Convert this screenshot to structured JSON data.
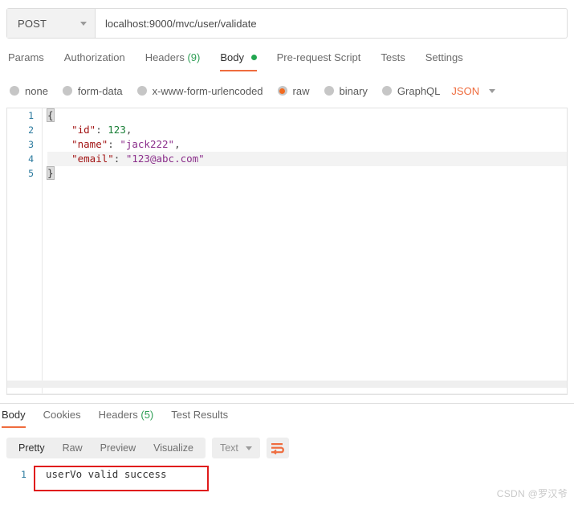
{
  "request": {
    "method": "POST",
    "url": "localhost:9000/mvc/user/validate",
    "method_caret_icon": "chevron-down-icon",
    "tabs": [
      {
        "label": "Params",
        "active": false
      },
      {
        "label": "Authorization",
        "active": false
      },
      {
        "label": "Headers",
        "count": "(9)",
        "active": false
      },
      {
        "label": "Body",
        "active": true,
        "dot": "green-dot-icon"
      },
      {
        "label": "Pre-request Script",
        "active": false
      },
      {
        "label": "Tests",
        "active": false
      },
      {
        "label": "Settings",
        "active": false
      }
    ],
    "body_types": [
      {
        "label": "none",
        "selected": false
      },
      {
        "label": "form-data",
        "selected": false
      },
      {
        "label": "x-www-form-urlencoded",
        "selected": false
      },
      {
        "label": "raw",
        "selected": true
      },
      {
        "label": "binary",
        "selected": false
      },
      {
        "label": "GraphQL",
        "selected": false
      }
    ],
    "format": "JSON",
    "format_caret_icon": "chevron-down-icon",
    "editor": {
      "line_numbers": [
        "1",
        "2",
        "3",
        "4",
        "5"
      ],
      "lines": [
        {
          "open_brace": "{"
        },
        {
          "indent": "    ",
          "key": "\"id\"",
          "colon": ": ",
          "num": "123",
          "tail": ","
        },
        {
          "indent": "    ",
          "key": "\"name\"",
          "colon": ": ",
          "str": "\"jack222\"",
          "tail": ","
        },
        {
          "indent": "    ",
          "key": "\"email\"",
          "colon": ": ",
          "str": "\"123@abc.com\"",
          "tail": ""
        },
        {
          "close_brace": "}"
        }
      ]
    }
  },
  "response": {
    "tabs": [
      {
        "label": "Body",
        "active": true
      },
      {
        "label": "Cookies",
        "active": false
      },
      {
        "label": "Headers",
        "count": "(5)",
        "active": false
      },
      {
        "label": "Test Results",
        "active": false
      }
    ],
    "formats": [
      {
        "label": "Pretty",
        "active": true
      },
      {
        "label": "Raw",
        "active": false
      },
      {
        "label": "Preview",
        "active": false
      },
      {
        "label": "Visualize",
        "active": false
      }
    ],
    "content_type": "Text",
    "content_type_caret_icon": "chevron-down-icon",
    "wrap_icon": "word-wrap-icon",
    "body": {
      "line_number": "1",
      "text": "userVo valid success"
    }
  },
  "watermark": "CSDN @罗汉爷",
  "colors": {
    "accent_orange": "#ef6c3e",
    "status_green": "#22a650",
    "annotation_red": "#e01b1b",
    "json_key": "#a31515",
    "json_string": "#8b2f8b",
    "json_number": "#1a7f37",
    "line_number": "#2b7a9e"
  }
}
